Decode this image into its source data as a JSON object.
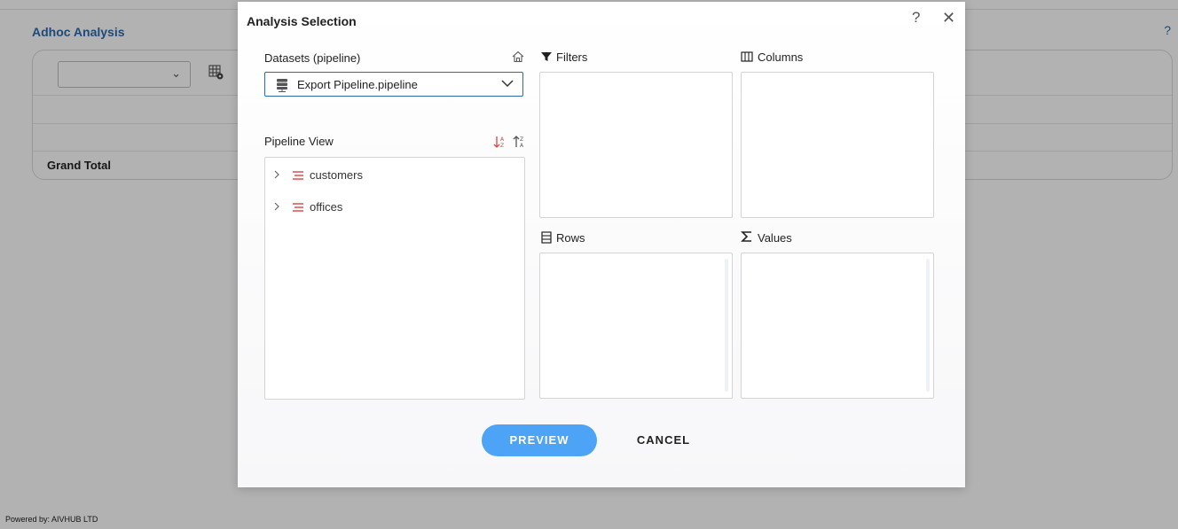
{
  "app": {
    "title": "Adhoc Analysis",
    "help": "?",
    "grand_total_label": "Grand Total",
    "powered_by": "Powered by: AIVHUB LTD"
  },
  "modal": {
    "title": "Analysis Selection",
    "help": "?",
    "close": "✕",
    "datasets_label": "Datasets (pipeline)",
    "dataset_selected": "Export Pipeline.pipeline",
    "pipeline_view_label": "Pipeline View",
    "tree_items": [
      {
        "label": "customers"
      },
      {
        "label": "offices"
      }
    ],
    "sections": {
      "filters": "Filters",
      "columns": "Columns",
      "rows": "Rows",
      "values": "Values"
    },
    "buttons": {
      "preview": "PREVIEW",
      "cancel": "CANCEL"
    }
  },
  "colors": {
    "accent": "#4da3f5",
    "link_blue": "#2b6cb0",
    "sort_red": "#e04040"
  },
  "icons": [
    "home-icon",
    "database-icon",
    "chevron-down-icon",
    "sort-ascending-icon",
    "sort-descending-icon",
    "chevron-right-icon",
    "table-icon",
    "filter-icon",
    "columns-icon",
    "rows-icon",
    "sigma-icon",
    "help-icon",
    "close-icon",
    "grid-settings-icon"
  ]
}
